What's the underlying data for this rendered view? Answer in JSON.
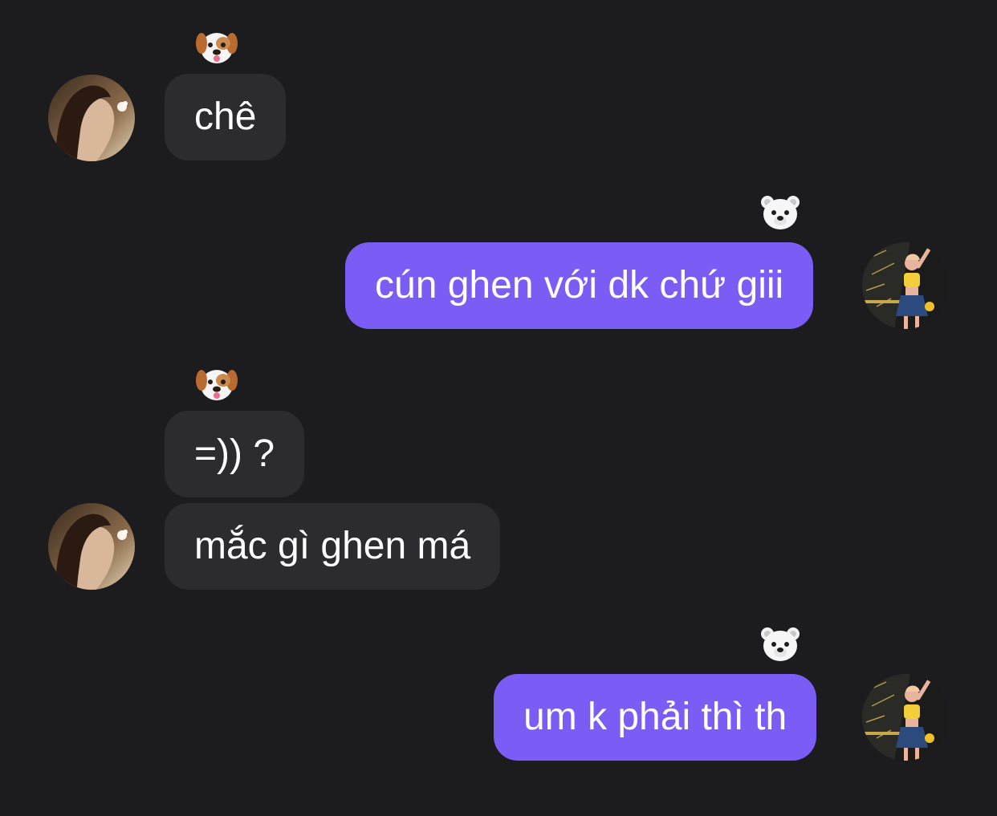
{
  "conversation": {
    "messages": [
      {
        "sender": "contact",
        "text": "chê",
        "reaction": "dog-face-emoji"
      },
      {
        "sender": "me",
        "text": "cún ghen với dk chứ giii",
        "reaction": "polar-bear-emoji"
      },
      {
        "sender": "contact",
        "text": "=)) ?",
        "reaction": "dog-face-emoji"
      },
      {
        "sender": "contact",
        "text": "mắc gì ghen má",
        "reaction": ""
      },
      {
        "sender": "me",
        "text": "um k phải thì th",
        "reaction": "polar-bear-emoji"
      }
    ]
  },
  "colors": {
    "background": "#1c1c1e",
    "incoming_bubble": "#2c2c2e",
    "outgoing_bubble": "#7b5cf5",
    "text": "#ffffff"
  },
  "icons": {
    "contact_avatar": "contact-avatar",
    "my_avatar": "my-avatar",
    "contact_reaction": "dog-face-emoji",
    "my_reaction": "polar-bear-emoji"
  }
}
